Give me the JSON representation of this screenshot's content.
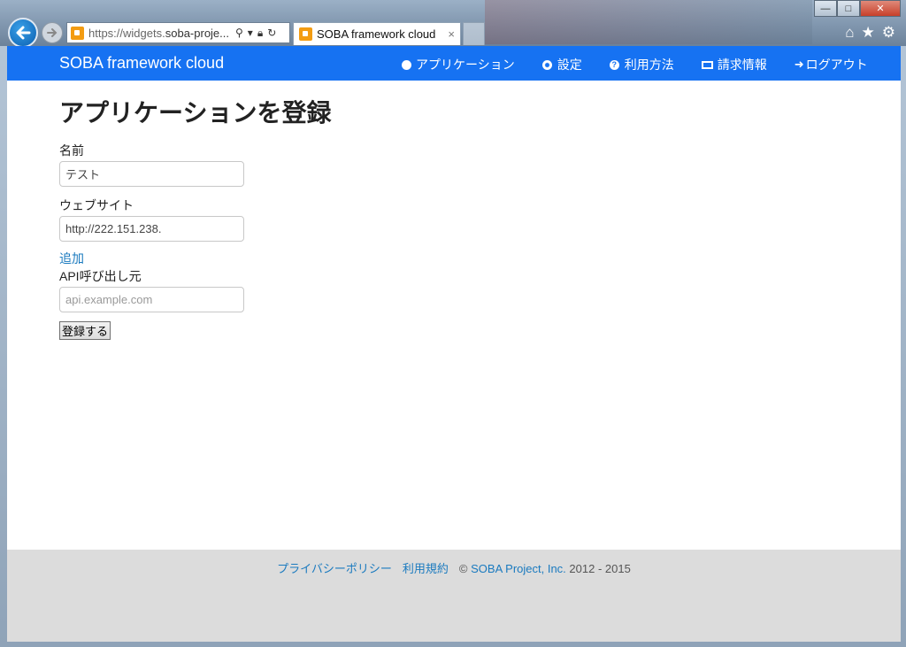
{
  "browser": {
    "url_prefix": "https://",
    "url_domain": "widgets.",
    "url_rest": "soba-proje...",
    "tab_title": "SOBA framework cloud",
    "tab_close": "×",
    "win_min": "—",
    "win_max": "□",
    "win_close": "✕"
  },
  "navbar": {
    "brand": "SOBA framework cloud",
    "items": [
      {
        "label": "アプリケーション",
        "icon": "globe-icon"
      },
      {
        "label": "設定",
        "icon": "gear-icon"
      },
      {
        "label": "利用方法",
        "icon": "question-icon"
      },
      {
        "label": "請求情報",
        "icon": "credit-card-icon"
      },
      {
        "label": "ログアウト",
        "icon": "arrow-right-icon"
      }
    ]
  },
  "form": {
    "title": "アプリケーションを登録",
    "name_label": "名前",
    "name_value": "テスト",
    "website_label": "ウェブサイト",
    "website_value": "http://222.151.238.",
    "add_link": "追加",
    "api_label": "API呼び出し元",
    "api_placeholder": "api.example.com",
    "submit_label": "登録する"
  },
  "footer": {
    "privacy": "プライバシーポリシー",
    "terms": "利用規約",
    "copyright_prefix": "©",
    "company": "SOBA Project, Inc.",
    "years": "2012 - 2015"
  }
}
